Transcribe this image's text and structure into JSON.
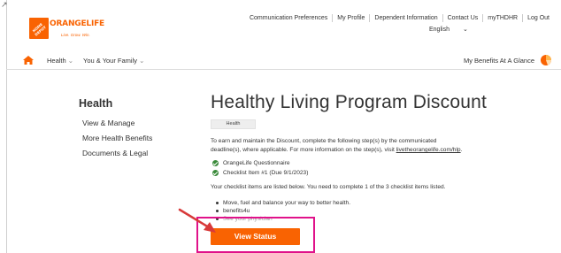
{
  "header": {
    "logo": {
      "brand": "ORANGELIFE",
      "tagline": "Live. Grow. Win.",
      "mark_text": "THE HOME DEPOT"
    },
    "top_links": [
      "Communication Preferences",
      "My Profile",
      "Dependent Information",
      "Contact Us",
      "myTHDHR",
      "Log Out"
    ],
    "language": "English"
  },
  "nav": {
    "home_icon": "home-icon",
    "items": [
      "Health",
      "You & Your Family"
    ],
    "benefits_link": "My Benefits At A Glance"
  },
  "sidebar": {
    "title": "Health",
    "links": [
      "View & Manage",
      "More Health Benefits",
      "Documents & Legal"
    ]
  },
  "main": {
    "title": "Healthy Living Program Discount",
    "tag": "Health",
    "intro_line1": "To earn and maintain the Discount, complete the following step(s) by the communicated",
    "intro_line2": "deadline(s), where applicable. For more information on the step(s), visit ",
    "intro_link": "livetheorangelife.com/hlp",
    "intro_end": ".",
    "checklist": [
      "OrangeLife Questionnaire",
      "Checklist Item #1 (Due 9/1/2023)"
    ],
    "checklist_intro": "Your checklist items are listed below. You need to complete 1 of the 3 checklist items listed.",
    "items": [
      "Move, fuel and balance your way to better health.",
      "benefits4u",
      "See your physician"
    ],
    "button": "View Status"
  },
  "colors": {
    "brand_orange": "#f96302",
    "highlight": "#e0128a",
    "check_green": "#3a8a3a"
  }
}
